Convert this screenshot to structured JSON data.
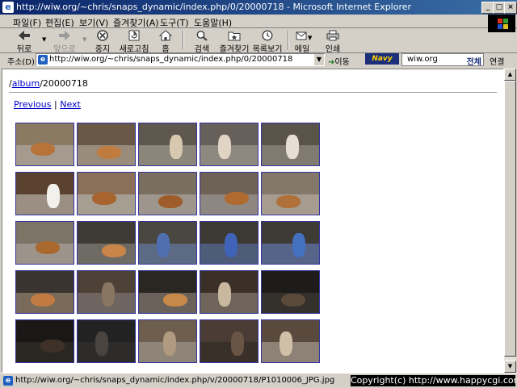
{
  "window": {
    "title": "http://wiw.org/~chris/snaps_dynamic/index.php/0/20000718 - Microsoft Internet Explorer"
  },
  "menu": [
    "파일(F)",
    "편집(E)",
    "보기(V)",
    "즐겨찾기(A)",
    "도구(T)",
    "도움말(H)"
  ],
  "toolbar": {
    "back": "뒤로",
    "forward": "앞으로",
    "stop": "중지",
    "refresh": "새로고침",
    "home": "홈",
    "search": "검색",
    "favorites": "즐겨찾기",
    "history": "목록보기",
    "mail": "메일",
    "print": "인쇄"
  },
  "address": {
    "label": "주소(D)",
    "url": "http://wiw.org/~chris/snaps_dynamic/index.php/0/20000718",
    "go": "이동",
    "navy_logo": "Navy",
    "search_value": "wiw.org",
    "search_all": "전체",
    "links": "연결"
  },
  "page": {
    "crumb_link": "album",
    "crumb_rest": "/20000718",
    "crumb_sep": "/",
    "previous": "Previous",
    "pipe": "|",
    "next": "Next"
  },
  "thumbnails": [
    {
      "wall": "#8a7a62",
      "floor": "#a49a8e",
      "subject": "dog",
      "color": "#b8733b"
    },
    {
      "wall": "#6a5846",
      "floor": "#9a8c7a",
      "subject": "dog",
      "color": "#c07b3e"
    },
    {
      "wall": "#5e584e",
      "floor": "#8b857a",
      "subject": "person",
      "color": "#d8c8b0"
    },
    {
      "wall": "#67605a",
      "floor": "#8e8880",
      "subject": "person",
      "color": "#e0d4c4"
    },
    {
      "wall": "#5a5448",
      "floor": "#807a70",
      "subject": "person",
      "color": "#e6ded2"
    },
    {
      "wall": "#5b4230",
      "floor": "#9a8f82",
      "subject": "person",
      "color": "#f2f0ea"
    },
    {
      "wall": "#8a7058",
      "floor": "#a79e92",
      "subject": "dog",
      "color": "#a8642e"
    },
    {
      "wall": "#7a6e60",
      "floor": "#9e968c",
      "subject": "dog",
      "color": "#9e5c2a"
    },
    {
      "wall": "#6e6256",
      "floor": "#8e8680",
      "subject": "dog",
      "color": "#b06a30"
    },
    {
      "wall": "#847868",
      "floor": "#a69c90",
      "subject": "dog",
      "color": "#b0703a"
    },
    {
      "wall": "#7d7468",
      "floor": "#9c948a",
      "subject": "dog",
      "color": "#a8682e"
    },
    {
      "wall": "#3e3a34",
      "floor": "#6e6a64",
      "subject": "dog",
      "color": "#c98448"
    },
    {
      "wall": "#4a4640",
      "floor": "#5c6a84",
      "subject": "person",
      "color": "#4f6fb0"
    },
    {
      "wall": "#3c3832",
      "floor": "#4e5c7a",
      "subject": "person",
      "color": "#3f63b8"
    },
    {
      "wall": "#3e3a36",
      "floor": "#556488",
      "subject": "person",
      "color": "#4470c0"
    },
    {
      "wall": "#3a3430",
      "floor": "#7a6a5a",
      "subject": "dog",
      "color": "#c07a42"
    },
    {
      "wall": "#4e4238",
      "floor": "#6e6460",
      "subject": "person",
      "color": "#8a7462"
    },
    {
      "wall": "#2a2622",
      "floor": "#6a625a",
      "subject": "dog",
      "color": "#c88a48"
    },
    {
      "wall": "#3a3028",
      "floor": "#6e645a",
      "subject": "person",
      "color": "#c8b8a0"
    },
    {
      "wall": "#1e1c1a",
      "floor": "#34302c",
      "subject": "dog",
      "color": "#5a4a3a"
    },
    {
      "wall": "#1a1816",
      "floor": "#2a2622",
      "subject": "dog",
      "color": "#3e3228"
    },
    {
      "wall": "#222",
      "floor": "#2e2c2a",
      "subject": "person",
      "color": "#4a4440"
    },
    {
      "wall": "#6e5e4e",
      "floor": "#8e8478",
      "subject": "person",
      "color": "#b09a80"
    },
    {
      "wall": "#4a3c34",
      "floor": "#3a302a",
      "subject": "person",
      "color": "#6a5444"
    },
    {
      "wall": "#5a4a3e",
      "floor": "#8e8276",
      "subject": "person",
      "color": "#d0c0a8"
    }
  ],
  "status": {
    "text": "http://wiw.org/~chris/snaps_dynamic/index.php/v/20000718/P1010006_JPG.jpg"
  },
  "watermark": "Copyright(c) http://www.happycgi.com"
}
